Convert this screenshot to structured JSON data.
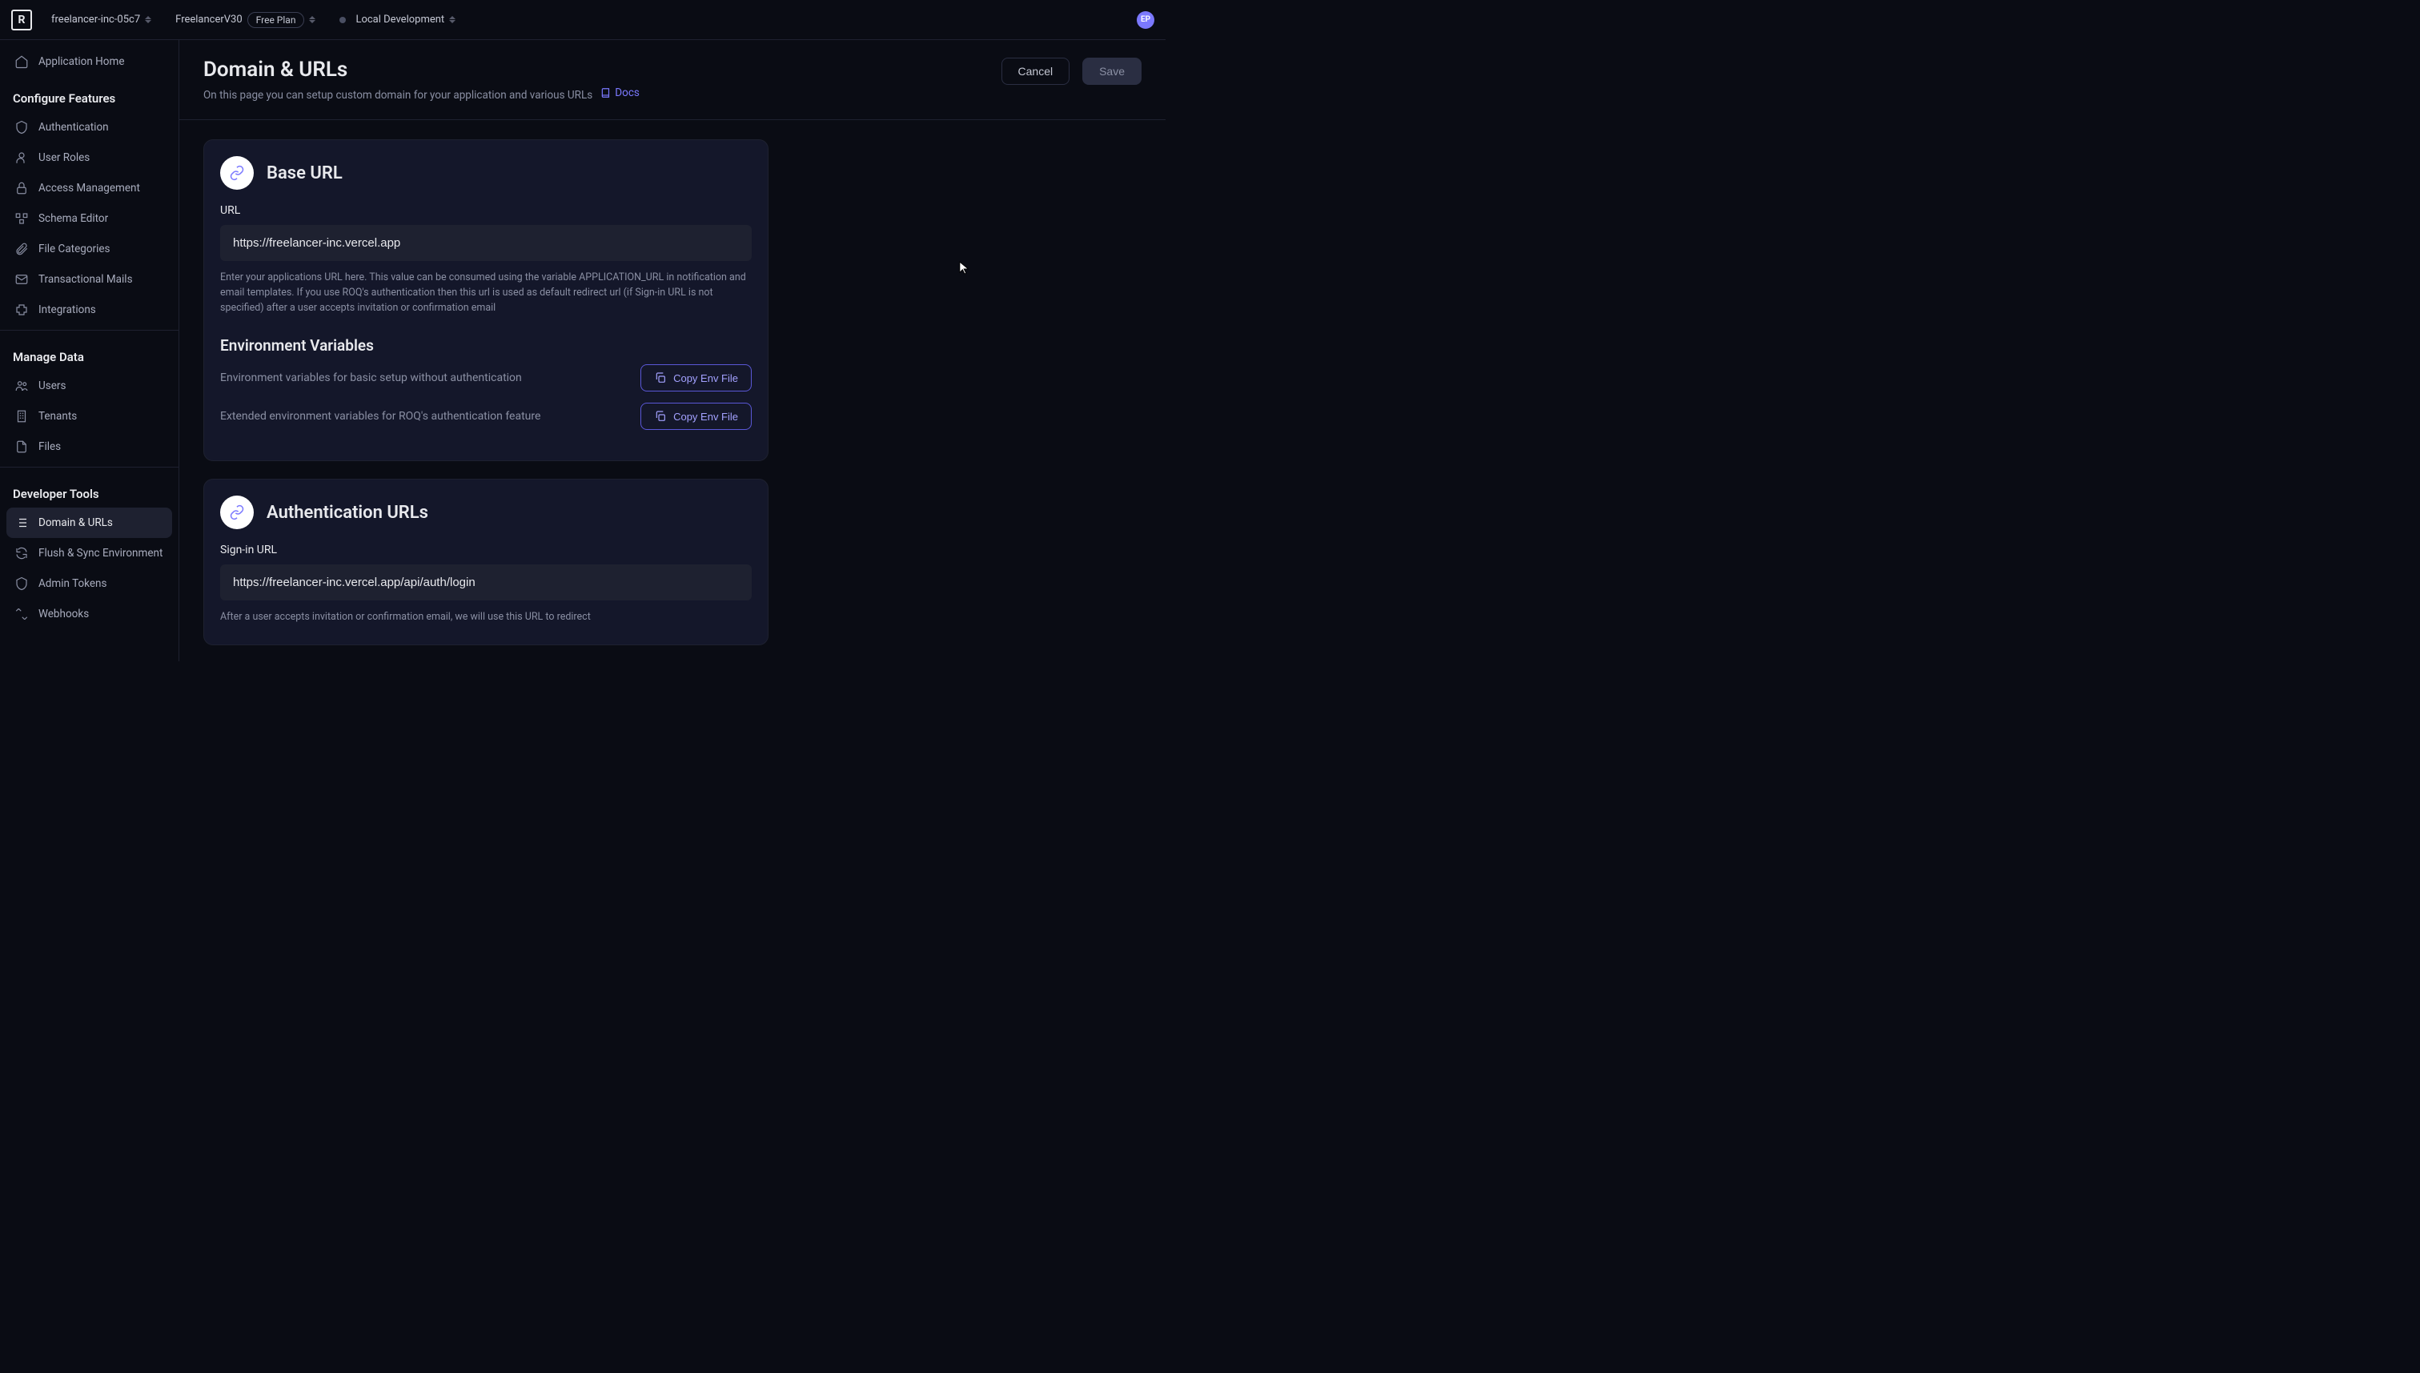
{
  "header": {
    "logo_text": "R",
    "org": "freelancer-inc-05c7",
    "project": "FreelancerV30",
    "plan": "Free Plan",
    "environment": "Local Development",
    "avatar_initials": "EP"
  },
  "sidebar": {
    "home": "Application Home",
    "section_features": "Configure Features",
    "features": [
      {
        "label": "Authentication",
        "icon": "shield"
      },
      {
        "label": "User Roles",
        "icon": "user"
      },
      {
        "label": "Access Management",
        "icon": "lock"
      },
      {
        "label": "Schema Editor",
        "icon": "schema"
      },
      {
        "label": "File Categories",
        "icon": "clip"
      },
      {
        "label": "Transactional Mails",
        "icon": "mail"
      },
      {
        "label": "Integrations",
        "icon": "puzzle"
      }
    ],
    "section_data": "Manage Data",
    "data": [
      {
        "label": "Users",
        "icon": "users"
      },
      {
        "label": "Tenants",
        "icon": "building"
      },
      {
        "label": "Files",
        "icon": "file"
      }
    ],
    "section_dev": "Developer Tools",
    "dev": [
      {
        "label": "Domain & URLs",
        "icon": "list",
        "active": true
      },
      {
        "label": "Flush & Sync Environment",
        "icon": "refresh"
      },
      {
        "label": "Admin Tokens",
        "icon": "shield"
      },
      {
        "label": "Webhooks",
        "icon": "collapse"
      }
    ]
  },
  "page": {
    "title": "Domain & URLs",
    "subtitle": "On this page you can setup custom domain for your application and various URLs",
    "docs_label": "Docs",
    "cancel": "Cancel",
    "save": "Save"
  },
  "base_url_card": {
    "title": "Base URL",
    "url_label": "URL",
    "url_value": "https://freelancer-inc.vercel.app",
    "url_help": "Enter your applications URL here. This value can be consumed using the variable APPLICATION_URL in notification and email templates. If you use ROQ's authentication then this url is used as default redirect url (if Sign-in URL is not specified) after a user accepts invitation or confirmation email",
    "env_heading": "Environment Variables",
    "env_basic_desc": "Environment variables for basic setup without authentication",
    "env_extended_desc": "Extended environment variables for ROQ's authentication feature",
    "copy_button": "Copy Env File"
  },
  "auth_urls_card": {
    "title": "Authentication URLs",
    "signin_label": "Sign-in URL",
    "signin_value": "https://freelancer-inc.vercel.app/api/auth/login",
    "signin_help": "After a user accepts invitation or confirmation email, we will use this URL to redirect"
  }
}
